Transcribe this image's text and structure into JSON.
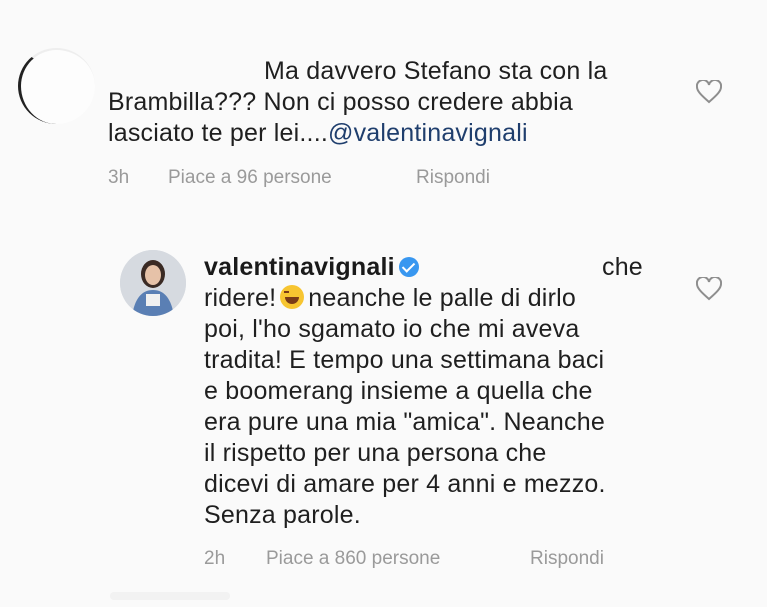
{
  "comment1": {
    "line1": "Ma davvero Stefano sta con la",
    "line2": "Brambilla??? Non ci posso credere abbia",
    "line3_text": "lasciato te per lei....",
    "line3_mention": "@valentinavignali",
    "meta": {
      "time": "3h",
      "likes": "Piace a 96 persone",
      "reply": "Rispondi"
    }
  },
  "comment2": {
    "username": "valentinavignali",
    "first_line_tail": "che",
    "line2_a": "ridere!",
    "line2_b": "neanche le palle di dirlo",
    "line3": "poi, l'ho sgamato io che mi aveva",
    "line4": "tradita! E tempo una settimana baci",
    "line5": "e boomerang insieme a quella che",
    "line6": "era pure una mia \"amica\". Neanche",
    "line7": "il rispetto per una persona che",
    "line8": "dicevi di amare per 4 anni e mezzo.",
    "line9": "Senza parole.",
    "meta": {
      "time": "2h",
      "likes": "Piace a 860 persone",
      "reply": "Rispondi"
    }
  },
  "icons": {
    "heart": "heart-icon",
    "verified": "verified-badge-icon",
    "emoji": "laughing-emoji-icon"
  },
  "colors": {
    "mention": "#1f3e6d",
    "verified": "#3897f0",
    "meta": "#9a9a9a"
  }
}
